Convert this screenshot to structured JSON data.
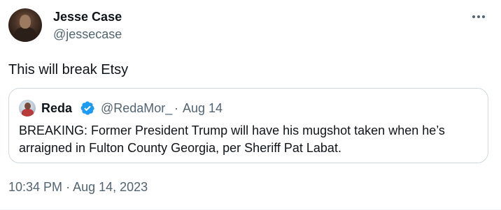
{
  "author": {
    "name": "Jesse Case",
    "handle": "@jessecase"
  },
  "tweet": {
    "text": "This will break Etsy",
    "time": "10:34 PM",
    "separator": "·",
    "date": "Aug 14, 2023"
  },
  "quoted": {
    "name": "Reda",
    "handle": "@RedaMor_",
    "separator": "·",
    "date": "Aug 14",
    "text": "BREAKING: Former President Trump will have his mugshot taken when he’s arraigned in Fulton County Georgia, per Sheriff Pat Labat."
  },
  "icons": {
    "more": "more-horizontal-icon",
    "verified": "verified-badge-icon"
  },
  "colors": {
    "text": "#0f1419",
    "secondary": "#536471",
    "verified": "#1d9bf0",
    "border": "#cfd9de"
  }
}
